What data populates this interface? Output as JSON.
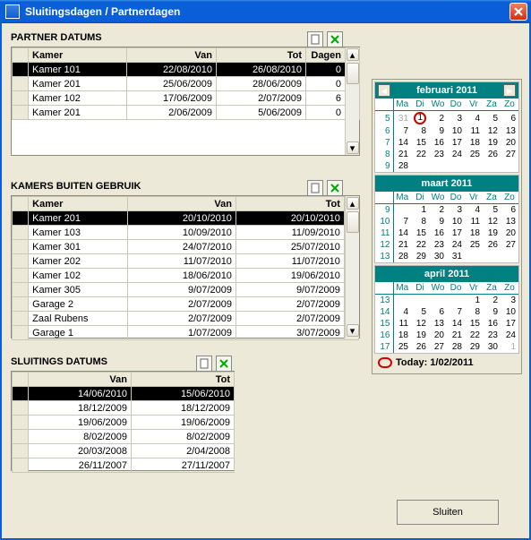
{
  "window": {
    "title": "Sluitingsdagen / Partnerdagen"
  },
  "sections": {
    "partner": {
      "title": "PARTNER DATUMS",
      "cols": [
        "Kamer",
        "Van",
        "Tot",
        "Dagen"
      ],
      "rows": [
        {
          "kamer": "Kamer 101",
          "van": "22/08/2010",
          "tot": "26/08/2010",
          "dagen": "0",
          "sel": true
        },
        {
          "kamer": "Kamer 201",
          "van": "25/06/2009",
          "tot": "28/06/2009",
          "dagen": "0"
        },
        {
          "kamer": "Kamer 102",
          "van": "17/06/2009",
          "tot": "2/07/2009",
          "dagen": "6"
        },
        {
          "kamer": "Kamer 201",
          "van": "2/06/2009",
          "tot": "5/06/2009",
          "dagen": "0"
        }
      ]
    },
    "buiten": {
      "title": "KAMERS BUITEN GEBRUIK",
      "cols": [
        "Kamer",
        "Van",
        "Tot"
      ],
      "rows": [
        {
          "kamer": "Kamer 201",
          "van": "20/10/2010",
          "tot": "20/10/2010",
          "sel": true
        },
        {
          "kamer": "Kamer 103",
          "van": "10/09/2010",
          "tot": "11/09/2010"
        },
        {
          "kamer": "Kamer 301",
          "van": "24/07/2010",
          "tot": "25/07/2010"
        },
        {
          "kamer": "Kamer 202",
          "van": "11/07/2010",
          "tot": "11/07/2010"
        },
        {
          "kamer": "Kamer 102",
          "van": "18/06/2010",
          "tot": "19/06/2010"
        },
        {
          "kamer": "Kamer 305",
          "van": "9/07/2009",
          "tot": "9/07/2009"
        },
        {
          "kamer": "Garage 2",
          "van": "2/07/2009",
          "tot": "2/07/2009"
        },
        {
          "kamer": "Zaal Rubens",
          "van": "2/07/2009",
          "tot": "2/07/2009"
        },
        {
          "kamer": "Garage 1",
          "van": "1/07/2009",
          "tot": "3/07/2009"
        }
      ]
    },
    "sluit": {
      "title": "SLUITINGS DATUMS",
      "cols": [
        "Van",
        "Tot"
      ],
      "rows": [
        {
          "van": "14/06/2010",
          "tot": "15/06/2010",
          "sel": true
        },
        {
          "van": "18/12/2009",
          "tot": "18/12/2009"
        },
        {
          "van": "19/06/2009",
          "tot": "19/06/2009"
        },
        {
          "van": "8/02/2009",
          "tot": "8/02/2009"
        },
        {
          "van": "20/03/2008",
          "tot": "2/04/2008"
        },
        {
          "van": "26/11/2007",
          "tot": "27/11/2007"
        }
      ]
    }
  },
  "cal": {
    "dow": [
      "Ma",
      "Di",
      "Wo",
      "Do",
      "Vr",
      "Za",
      "Zo"
    ],
    "months": [
      {
        "name": "februari 2011",
        "nav": true,
        "weeks": [
          {
            "wk": "5",
            "d": [
              {
                "t": "31",
                "m": true
              },
              {
                "t": "1",
                "today": true
              },
              {
                "t": "2"
              },
              {
                "t": "3"
              },
              {
                "t": "4"
              },
              {
                "t": "5"
              },
              {
                "t": "6"
              }
            ]
          },
          {
            "wk": "6",
            "d": [
              {
                "t": "7"
              },
              {
                "t": "8"
              },
              {
                "t": "9"
              },
              {
                "t": "10"
              },
              {
                "t": "11"
              },
              {
                "t": "12"
              },
              {
                "t": "13"
              }
            ]
          },
          {
            "wk": "7",
            "d": [
              {
                "t": "14"
              },
              {
                "t": "15"
              },
              {
                "t": "16"
              },
              {
                "t": "17"
              },
              {
                "t": "18"
              },
              {
                "t": "19"
              },
              {
                "t": "20"
              }
            ]
          },
          {
            "wk": "8",
            "d": [
              {
                "t": "21"
              },
              {
                "t": "22"
              },
              {
                "t": "23"
              },
              {
                "t": "24"
              },
              {
                "t": "25"
              },
              {
                "t": "26"
              },
              {
                "t": "27"
              }
            ]
          },
          {
            "wk": "9",
            "d": [
              {
                "t": "28"
              },
              {
                "t": ""
              },
              {
                "t": ""
              },
              {
                "t": ""
              },
              {
                "t": ""
              },
              {
                "t": ""
              },
              {
                "t": ""
              }
            ]
          }
        ]
      },
      {
        "name": "maart 2011",
        "nav": false,
        "weeks": [
          {
            "wk": "9",
            "d": [
              {
                "t": ""
              },
              {
                "t": "1"
              },
              {
                "t": "2"
              },
              {
                "t": "3"
              },
              {
                "t": "4"
              },
              {
                "t": "5"
              },
              {
                "t": "6"
              }
            ]
          },
          {
            "wk": "10",
            "d": [
              {
                "t": "7"
              },
              {
                "t": "8"
              },
              {
                "t": "9"
              },
              {
                "t": "10"
              },
              {
                "t": "11"
              },
              {
                "t": "12"
              },
              {
                "t": "13"
              }
            ]
          },
          {
            "wk": "11",
            "d": [
              {
                "t": "14"
              },
              {
                "t": "15"
              },
              {
                "t": "16"
              },
              {
                "t": "17"
              },
              {
                "t": "18"
              },
              {
                "t": "19"
              },
              {
                "t": "20"
              }
            ]
          },
          {
            "wk": "12",
            "d": [
              {
                "t": "21"
              },
              {
                "t": "22"
              },
              {
                "t": "23"
              },
              {
                "t": "24"
              },
              {
                "t": "25"
              },
              {
                "t": "26"
              },
              {
                "t": "27"
              }
            ]
          },
          {
            "wk": "13",
            "d": [
              {
                "t": "28"
              },
              {
                "t": "29"
              },
              {
                "t": "30"
              },
              {
                "t": "31"
              },
              {
                "t": ""
              },
              {
                "t": ""
              },
              {
                "t": ""
              }
            ]
          }
        ]
      },
      {
        "name": "april 2011",
        "nav": false,
        "weeks": [
          {
            "wk": "13",
            "d": [
              {
                "t": ""
              },
              {
                "t": ""
              },
              {
                "t": ""
              },
              {
                "t": ""
              },
              {
                "t": "1"
              },
              {
                "t": "2"
              },
              {
                "t": "3"
              }
            ]
          },
          {
            "wk": "14",
            "d": [
              {
                "t": "4"
              },
              {
                "t": "5"
              },
              {
                "t": "6"
              },
              {
                "t": "7"
              },
              {
                "t": "8"
              },
              {
                "t": "9"
              },
              {
                "t": "10"
              }
            ]
          },
          {
            "wk": "15",
            "d": [
              {
                "t": "11"
              },
              {
                "t": "12"
              },
              {
                "t": "13"
              },
              {
                "t": "14"
              },
              {
                "t": "15"
              },
              {
                "t": "16"
              },
              {
                "t": "17"
              }
            ]
          },
          {
            "wk": "16",
            "d": [
              {
                "t": "18"
              },
              {
                "t": "19"
              },
              {
                "t": "20"
              },
              {
                "t": "21"
              },
              {
                "t": "22"
              },
              {
                "t": "23"
              },
              {
                "t": "24"
              }
            ]
          },
          {
            "wk": "17",
            "d": [
              {
                "t": "25"
              },
              {
                "t": "26"
              },
              {
                "t": "27"
              },
              {
                "t": "28"
              },
              {
                "t": "29"
              },
              {
                "t": "30"
              },
              {
                "t": "1",
                "m": true
              }
            ]
          }
        ]
      }
    ],
    "today_label": "Today: 1/02/2011"
  },
  "buttons": {
    "close": "Sluiten"
  }
}
